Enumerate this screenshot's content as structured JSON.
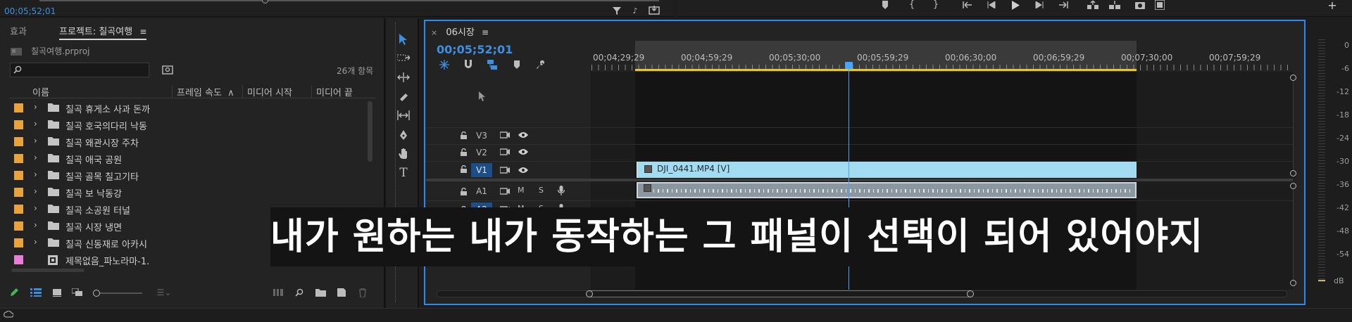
{
  "top_bar": {
    "timecode": "00;05;52;01"
  },
  "project_panel": {
    "tabs": {
      "effects": "효과",
      "project": "프로젝트: 칠곡여행"
    },
    "file_name": "칠곡여행.prproj",
    "search_placeholder": "",
    "item_count": "26개 항목",
    "columns": {
      "name": "이름",
      "frame_rate": "프레임 속도",
      "media_start": "미디어 시작",
      "media_end": "미디어 끝"
    },
    "items": [
      {
        "label": "칠곡 휴게소 사과 돈까",
        "color": "#e8a33c",
        "type": "folder"
      },
      {
        "label": "칠곡 호국의다리 낙동",
        "color": "#e8a33c",
        "type": "folder"
      },
      {
        "label": "칠곡 왜관시장 주차",
        "color": "#e8a33c",
        "type": "folder"
      },
      {
        "label": "칠곡 애국 공원",
        "color": "#e8a33c",
        "type": "folder"
      },
      {
        "label": "칠곡 골목 칠고기타",
        "color": "#e8a33c",
        "type": "folder"
      },
      {
        "label": "칠곡 보 낙동강",
        "color": "#e8a33c",
        "type": "folder"
      },
      {
        "label": "칠곡 소공원 터널",
        "color": "#e8a33c",
        "type": "folder"
      },
      {
        "label": "칠곡 시장 냉면",
        "color": "#e8a33c",
        "type": "folder"
      },
      {
        "label": "칠곡 신동재로 아카시",
        "color": "#e8a33c",
        "type": "folder"
      },
      {
        "label": "제목없음_파노라마-1.",
        "color": "#e87fd6",
        "type": "sequence"
      }
    ]
  },
  "timeline": {
    "sequence_tab": "06시장",
    "timecode": "00;05;52;01",
    "ruler_labels": [
      "00;04;29;29",
      "00;04;59;29",
      "00;05;30;00",
      "00;05;59;29",
      "00;06;30;00",
      "00;06;59;29",
      "00;07;30;00",
      "00;07;59;29"
    ],
    "tracks": {
      "v3": "V3",
      "v2": "V2",
      "v1": "V1",
      "a1": "A1",
      "a2": "A2"
    },
    "track_buttons": {
      "mute": "M",
      "solo": "S"
    },
    "clip_video": "DJI_0441.MP4 [V]"
  },
  "meter": {
    "labels": [
      "0",
      "-6",
      "-12",
      "-18",
      "-24",
      "-30",
      "-36",
      "-42",
      "-48",
      "-54"
    ],
    "unit": "dB"
  },
  "caption": "내가 원하는 내가 동작하는 그 패널이 선택이 되어 있어야지",
  "colors": {
    "accent": "#2d8ceb",
    "clip_video": "#a3dcf0",
    "playhead": "#4aa3ff",
    "in_out": "#e4c62e"
  }
}
